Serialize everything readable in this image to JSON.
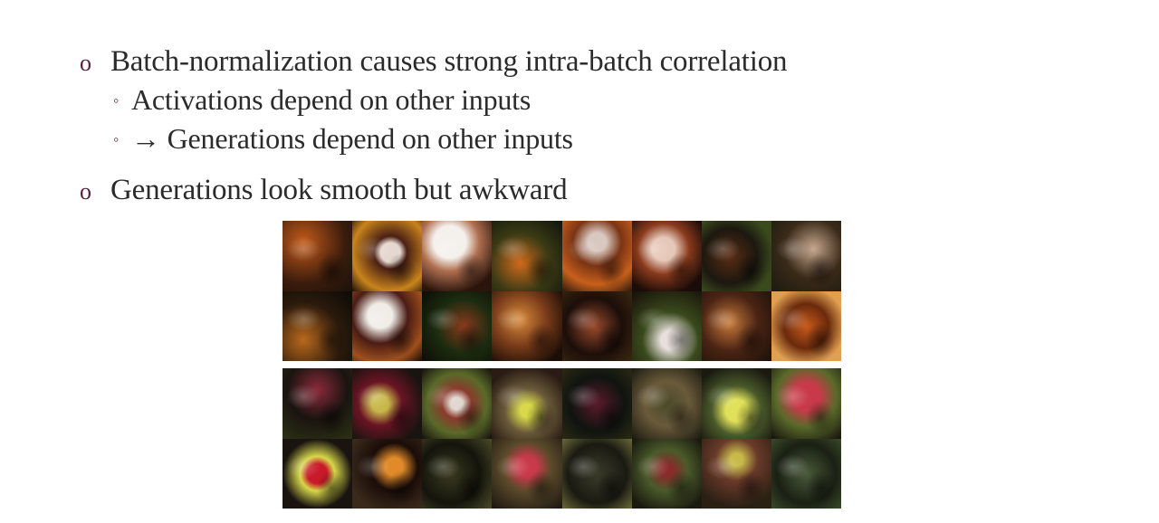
{
  "bullets": [
    {
      "marker": "o",
      "text": "Batch-normalization causes strong intra-batch correlation",
      "sub": [
        {
          "marker": "◦",
          "text": "Activations depend on other inputs"
        },
        {
          "marker": "◦",
          "text": "→ Generations depend on other inputs"
        }
      ]
    },
    {
      "marker": "o",
      "text": "Generations look smooth but awkward"
    }
  ],
  "figure": {
    "top_grid": {
      "rows": 2,
      "cols": 8
    },
    "bottom_grid": {
      "rows": 2,
      "cols": 8
    }
  }
}
